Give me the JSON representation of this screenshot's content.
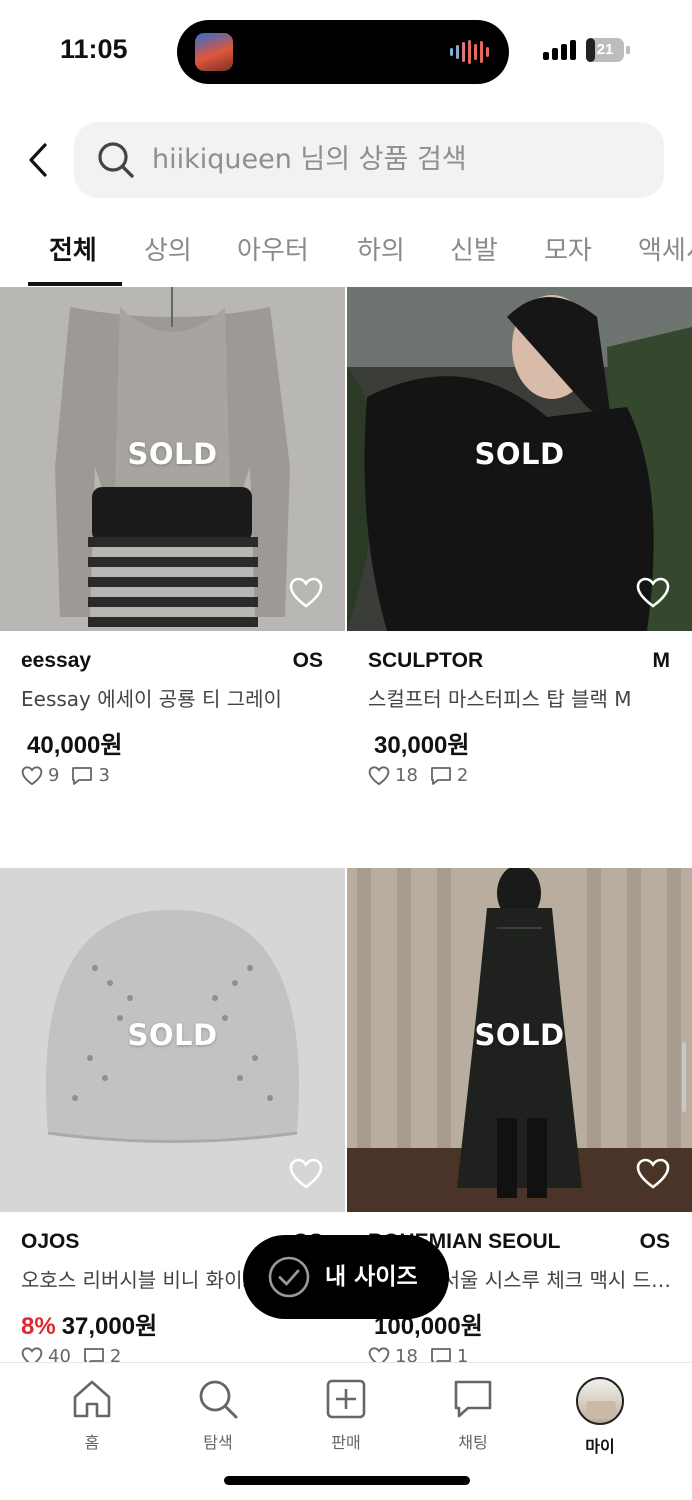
{
  "status_bar": {
    "time": "11:05",
    "battery": "21"
  },
  "search": {
    "placeholder": "hiikiqueen 님의 상품 검색"
  },
  "tabs": [
    {
      "label": "전체",
      "active": true
    },
    {
      "label": "상의"
    },
    {
      "label": "아우터"
    },
    {
      "label": "하의"
    },
    {
      "label": "신발"
    },
    {
      "label": "모자"
    },
    {
      "label": "액세서"
    }
  ],
  "products": [
    {
      "status": "SOLD",
      "brand": "eessay",
      "size": "OS",
      "title": "Eessay 에세이 공룡 티 그레이",
      "discount": "",
      "price": "40,000원",
      "likes": "9",
      "comments": "3"
    },
    {
      "status": "SOLD",
      "brand": "SCULPTOR",
      "size": "M",
      "title": "스컬프터 마스터피스 탑 블랙 M",
      "discount": "",
      "price": "30,000원",
      "likes": "18",
      "comments": "2"
    },
    {
      "status": "SOLD",
      "brand": "OJOS",
      "size": "OS",
      "title": "오호스 리버시블 비니 화이트",
      "discount": "8%",
      "price": "37,000원",
      "likes": "40",
      "comments": "2"
    },
    {
      "status": "SOLD",
      "brand": "BOHEMIAN SEOUL",
      "size": "OS",
      "title": "보헤미안서울 시스루 체크 맥시 드레스",
      "discount": "",
      "price": "100,000원",
      "likes": "18",
      "comments": "1"
    }
  ],
  "floating_button": {
    "label": "내 사이즈"
  },
  "bottom_nav": [
    {
      "label": "홈",
      "icon": "home-icon"
    },
    {
      "label": "탐색",
      "icon": "search-icon"
    },
    {
      "label": "판매",
      "icon": "plus-square-icon"
    },
    {
      "label": "채팅",
      "icon": "chat-icon"
    },
    {
      "label": "마이",
      "icon": "avatar",
      "active": true
    }
  ],
  "colors": {
    "accent_discount": "#e0272f",
    "text_primary": "#111111",
    "text_muted": "#8a8a8a"
  }
}
